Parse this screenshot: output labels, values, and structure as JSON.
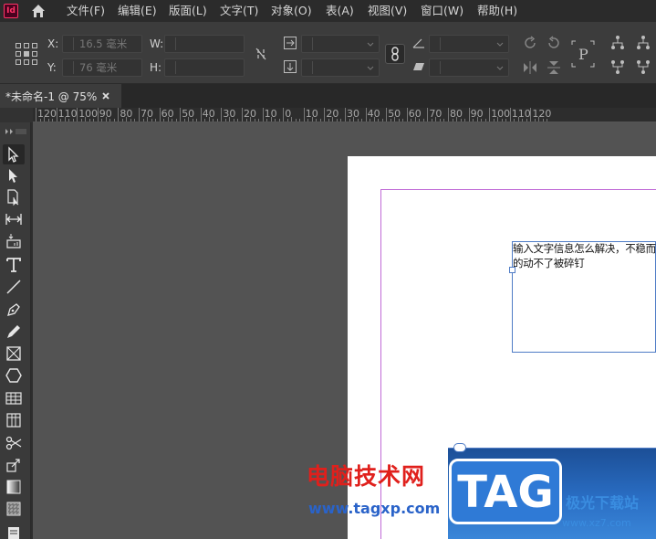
{
  "app": {
    "logo": "Id"
  },
  "menu": {
    "items": [
      "文件(F)",
      "编辑(E)",
      "版面(L)",
      "文字(T)",
      "对象(O)",
      "表(A)",
      "视图(V)",
      "窗口(W)",
      "帮助(H)"
    ]
  },
  "control": {
    "x_label": "X:",
    "x_value": "16.5 毫米",
    "y_label": "Y:",
    "y_value": "76 毫米",
    "w_label": "W:",
    "w_value": "",
    "h_label": "H:",
    "h_value": ""
  },
  "document": {
    "tab_title": "*未命名-1 @ 75%"
  },
  "ruler": {
    "ticks": [
      "120",
      "110",
      "100",
      "90",
      "80",
      "70",
      "60",
      "50",
      "40",
      "30",
      "20",
      "10",
      "0",
      "10",
      "20",
      "30",
      "40",
      "50",
      "60",
      "70",
      "80",
      "90",
      "100",
      "110",
      "120"
    ]
  },
  "frame": {
    "text": "输入文字信息怎么解决，不稳而的动不了被碎钉"
  },
  "watermark": {
    "cn": "电脑技术网",
    "url": "www.tagxp.com",
    "tag": "TAG",
    "site_cn": "极光下载站",
    "site_url": "www.xz7.com"
  },
  "colors": {
    "accent_pink": "#ff3366",
    "frame_blue": "#4f7cc6",
    "margin_guide": "#c06ad6"
  }
}
